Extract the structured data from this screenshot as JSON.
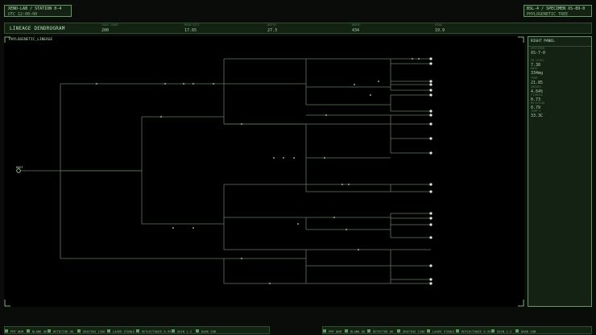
{
  "header_left": {
    "line1": "XENO-LAB / STATION 0-4",
    "line2": "UTC 12:00:00"
  },
  "header_right": {
    "line1": "BSL-4 / SPECIMEN XS-89-0",
    "line2": "PHYLOGENETIC_TREE"
  },
  "title_bar": {
    "title": "LINEAGE DENDROGRAM",
    "metrics": [
      {
        "label": "TAXA COUNT",
        "value": "200"
      },
      {
        "label": "MEAN DIST",
        "value": "17.65"
      },
      {
        "label": "DEPTH",
        "value": "27.3"
      },
      {
        "label": "NODES",
        "value": "434"
      },
      {
        "label": "SPAN",
        "value": "19.9"
      }
    ]
  },
  "tree_panel": {
    "label": "PHYLOGENETIC_LINEAGE",
    "root_label": "ROOT"
  },
  "right_panel": {
    "title": "RIGHT PANEL",
    "fields": [
      {
        "label": "SPECIMEN",
        "value": "XS-7-0"
      },
      {
        "label": "PH LEVEL",
        "value": "7.38"
      },
      {
        "label": "MASS",
        "value": "334mg"
      },
      {
        "label": "TEMP",
        "value": "21.85"
      },
      {
        "label": "GROWTH",
        "value": "4.64%"
      },
      {
        "label": "FITNESS",
        "value": "0.73"
      },
      {
        "label": "MUTATION",
        "value": "0.79"
      },
      {
        "label": "TEMP C",
        "value": "33.3C"
      }
    ]
  },
  "status_left": [
    {
      "label": "PMT NOM"
    },
    {
      "label": "BLANK OK"
    },
    {
      "label": "DETECTOR OK"
    },
    {
      "label": "GRATING 1200"
    },
    {
      "label": "LASER STABLE"
    },
    {
      "label": "REFLECTANCE 0.95"
    },
    {
      "label": "GAIN 1.2"
    },
    {
      "label": "DARK SUB"
    }
  ],
  "status_right": [
    {
      "label": "PMT NOM"
    },
    {
      "label": "BLANK OK"
    },
    {
      "label": "DETECTOR OK"
    },
    {
      "label": "GRATING 1200"
    },
    {
      "label": "LASER STABLE"
    },
    {
      "label": "REFLECTANCE 0.95"
    },
    {
      "label": "GAIN 1.2"
    },
    {
      "label": "DARK SUB"
    }
  ]
}
